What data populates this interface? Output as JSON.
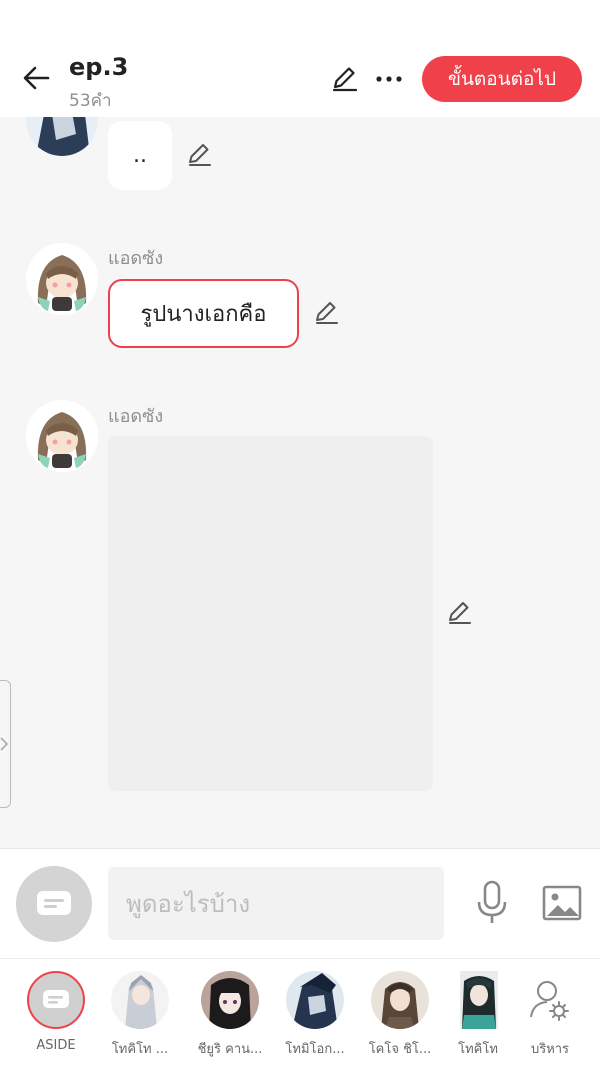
{
  "header": {
    "title": "ep.3",
    "word_count": "53คำ",
    "next_label": "ขั้นตอนต่อไป"
  },
  "messages": [
    {
      "sender": "",
      "text": "..",
      "type": "text"
    },
    {
      "sender": "แอดซัง",
      "text": "รูปนางเอกคือ",
      "type": "text",
      "highlighted": true
    },
    {
      "sender": "แอดซัง",
      "text": "",
      "type": "image"
    }
  ],
  "composer": {
    "placeholder": "พูดอะไรบ้าง"
  },
  "characters": [
    {
      "name": "ASIDE"
    },
    {
      "name": "โทคิโท ..."
    },
    {
      "name": "ชียูริ คาน..."
    },
    {
      "name": "โทมิโอก..."
    },
    {
      "name": "โคโจ ชิโ..."
    },
    {
      "name": "โทคิโท"
    },
    {
      "name": "บริหาร"
    }
  ],
  "colors": {
    "accent": "#f0404a",
    "background": "#f6f6f6"
  }
}
